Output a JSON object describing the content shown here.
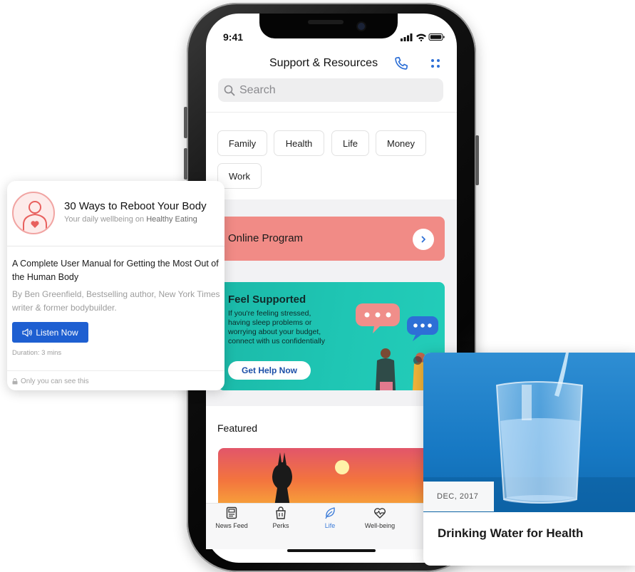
{
  "status_bar": {
    "time": "9:41"
  },
  "header": {
    "title": "Support & Resources",
    "phone_icon": "phone-icon",
    "menu_icon": "grid-dots-icon"
  },
  "search": {
    "placeholder": "Search",
    "icon": "search-icon"
  },
  "categories": [
    "Family",
    "Health",
    "Life",
    "Money",
    "Work"
  ],
  "online_program": {
    "label": "Online Program",
    "icon": "chevron-right-icon"
  },
  "support_card": {
    "title": "Feel Supported",
    "body": "If you're feeling stressed, having sleep problems or worrying about your budget, connect with us confidentially",
    "button": "Get Help Now",
    "colors": {
      "bg": "#1fc6b4",
      "button_text": "#1b4fa8"
    }
  },
  "featured": {
    "title": "Featured"
  },
  "tabbar": {
    "items": [
      {
        "label": "News Feed",
        "icon": "newspaper-icon",
        "active": false
      },
      {
        "label": "Perks",
        "icon": "shopping-bag-icon",
        "active": false
      },
      {
        "label": "Life",
        "icon": "leaf-icon",
        "active": true
      },
      {
        "label": "Well-being",
        "icon": "heart-pulse-icon",
        "active": false
      }
    ],
    "active_color": "#3b7bd8"
  },
  "card_left": {
    "title": "30 Ways to Reboot Your Body",
    "subtitle_prefix": "Your daily wellbeing on",
    "subtitle_topic": "Healthy Eating",
    "heading": "A Complete User Manual for Getting the Most Out of the Human Body",
    "author": "By Ben Greenfield, Bestselling author, New York Times writer & former bodybuilder.",
    "button": "Listen Now",
    "duration": "Duration: 3 mins",
    "privacy": "Only you can see this",
    "colors": {
      "button": "#1e5fd1",
      "avatar_accent": "#e8605e"
    }
  },
  "card_right": {
    "date": "DEC, 2017",
    "title": "Drinking Water for Health"
  },
  "colors": {
    "online_program": "#f18b86",
    "accent_blue": "#3b7bd8"
  }
}
